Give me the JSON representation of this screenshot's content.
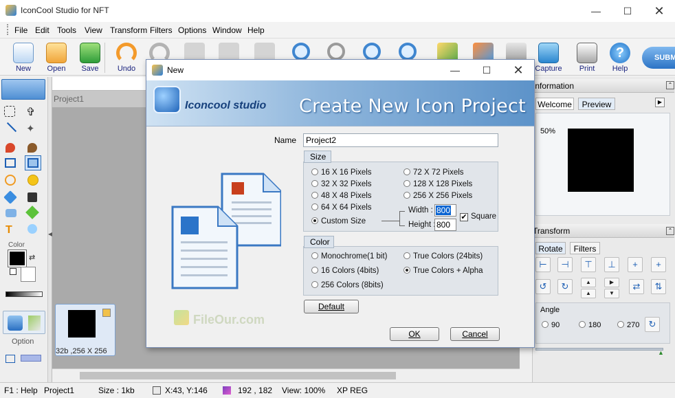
{
  "window": {
    "title": "IconCool Studio for NFT"
  },
  "menu": [
    "File",
    "Edit",
    "Tools",
    "View",
    "Transform",
    "Filters",
    "Options",
    "Window",
    "Help"
  ],
  "toolbar": [
    {
      "label": "New",
      "icon": "new-document-icon"
    },
    {
      "label": "Open",
      "icon": "open-folder-icon"
    },
    {
      "label": "Save",
      "icon": "save-icon"
    },
    {
      "label": "Undo",
      "icon": "undo-icon"
    },
    {
      "label": "",
      "icon": "redo-icon"
    },
    {
      "label": "Capture",
      "icon": "capture-icon"
    },
    {
      "label": "Print",
      "icon": "print-icon"
    },
    {
      "label": "Help",
      "icon": "help-icon"
    },
    {
      "label": "SUBM",
      "icon": "submit-icon"
    }
  ],
  "left_panel": {
    "color_label": "Color",
    "option_label": "Option"
  },
  "canvas": {
    "tab": "Project1",
    "thumb_label": "32b ,256 X 256",
    "watermark": "FileOur.com"
  },
  "right_panel": {
    "info_title": "Information",
    "tabs": [
      "Welcome",
      "Preview"
    ],
    "zoom": "50%",
    "transform_title": "Transform",
    "transform_tabs": [
      "Rotate",
      "Filters"
    ],
    "angle_label": "Angle",
    "angles": [
      "90",
      "180",
      "270"
    ]
  },
  "dialog": {
    "title": "New",
    "logo": "Iconcool studio",
    "heading": "Create New Icon Project",
    "name_label": "Name",
    "name_value": "Project2",
    "size_label": "Size",
    "sizes_left": [
      "16 X 16 Pixels",
      "32 X 32 Pixels",
      "48 X 48 Pixels",
      "64 X 64 Pixels",
      "Custom Size"
    ],
    "sizes_right": [
      "72 X 72 Pixels",
      "128 X 128 Pixels",
      "256 X 256 Pixels"
    ],
    "width_label": "Width :",
    "width_value": "800",
    "height_label": "Height :",
    "height_value": "800",
    "square_label": "Square",
    "color_label": "Color",
    "colors_left": [
      "Monochrome(1 bit)",
      "16 Colors (4bits)",
      "256 Colors (8bits)"
    ],
    "colors_right": [
      "True Colors (24bits)",
      "True Colors + Alpha"
    ],
    "default_btn": "Default",
    "ok_btn": "OK",
    "cancel_btn": "Cancel"
  },
  "status": {
    "help": "F1 : Help",
    "project": "Project1",
    "size": "Size : 1kb",
    "cursor": "X:43, Y:146",
    "dims": "192 , 182",
    "view": "View: 100%",
    "mode": "XP REG"
  },
  "colors": {
    "accent": "#3a78c3",
    "banner_text": "#ffffff",
    "selection": "#0a64d2"
  }
}
